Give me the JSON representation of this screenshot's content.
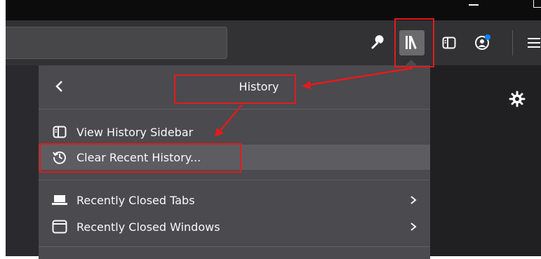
{
  "toolbar": {
    "icons": [
      "wrench-icon",
      "library-icon",
      "sidebar-icon",
      "account-icon",
      "menu-icon"
    ],
    "account_badge_color": "#0a84ff"
  },
  "panel": {
    "title": "History",
    "back_icon": "chevron-left-icon",
    "items": [
      {
        "label": "View History Sidebar",
        "icon": "sidebar-icon"
      },
      {
        "label": "Clear Recent History...",
        "icon": "history-clock-icon",
        "highlighted": true
      },
      {
        "label": "Recently Closed Tabs",
        "icon": "tab-icon",
        "has_submenu": true
      },
      {
        "label": "Recently Closed Windows",
        "icon": "window-icon",
        "has_submenu": true
      }
    ]
  },
  "content": {
    "settings_icon": "gear-icon"
  },
  "colors": {
    "annotation": "#e31b1b",
    "panel_background": "#4a4a4f",
    "toolbar_background": "#323234",
    "highlight_background": "#5d5d61"
  }
}
